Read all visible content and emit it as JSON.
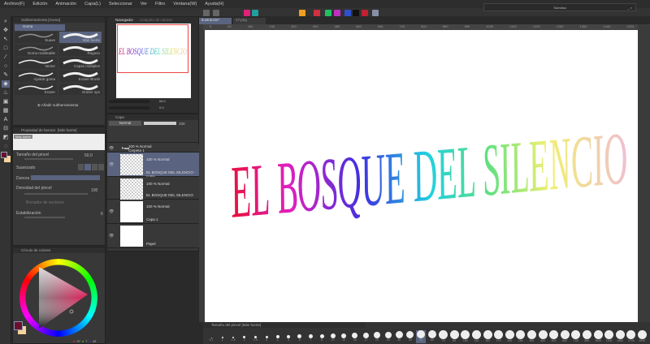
{
  "menu": [
    "Archivo(F)",
    "Edición",
    "Animación",
    "Capa(L)",
    "Seleccionar",
    "Ver",
    "Filtro",
    "Ventana(W)",
    "Ayuda(H)"
  ],
  "colors": {
    "accent": "#5a6480",
    "main_color": "#6b1030",
    "sub_color": "#f5d49a"
  },
  "subview": {
    "title": "Subvista"
  },
  "subtool": {
    "tab": "Subherramienta [Goma]",
    "group": "Goma",
    "brushes": [
      "Suave",
      "Más fuerte",
      "Goma moldeable",
      "Rugoso",
      "Vector",
      "Capas múltiples",
      "Ajustar goma",
      "Eraser Brush",
      "Eraser",
      "Eraser 1px"
    ],
    "add": "Añadir subherramienta"
  },
  "navigator": {
    "tabs": [
      "Navegador",
      "Conjunto de colores"
    ],
    "zoom": "66.0",
    "angle": "0.0"
  },
  "toolprop": {
    "tab": "Propiedad de herram. [Más fuerte]",
    "preset": "Más fuerte",
    "size_label": "Tamaño del pincel",
    "size_value": "50.0",
    "smooth_label": "Suavizado",
    "hardness_label": "Dureza",
    "density_label": "Densidad del pincel",
    "density_value": "100",
    "vector_label": "Borrador de vectores",
    "stab_label": "Estabilización",
    "stab_value": "6"
  },
  "colorwheel": {
    "tab": "Círculo de colores",
    "r": "97",
    "g": "7",
    "b": "43"
  },
  "layers": {
    "tab": "Capa",
    "blend": "Normal",
    "opacity": "100",
    "items": [
      {
        "mode": "100 % Normal",
        "name": "Carpeta 1"
      },
      {
        "mode": "100 % Normal",
        "name": "EL BOSQUE DEL SILENCIO - copia"
      },
      {
        "mode": "100 % Normal",
        "name": "EL BOSQUE DEL SILENCIO"
      },
      {
        "mode": "100 % Normal",
        "name": "Capa 1"
      },
      {
        "mode": "",
        "name": "Papel"
      }
    ]
  },
  "canvas": {
    "tabs": [
      "Ilustración*",
      "17.png"
    ],
    "title": "EL BOSQUE DEL SILENCIO",
    "ruler": [
      "0",
      "80",
      "160",
      "240",
      "320",
      "400",
      "480",
      "560",
      "640",
      "720",
      "800",
      "880",
      "960",
      "1040",
      "1120",
      "1200",
      "1280",
      "1360",
      "1440",
      "1520",
      "1600",
      "1680",
      "1760",
      "1840",
      "1920"
    ]
  },
  "brushsize": {
    "tab": "Tamaño del pincel [Más fuerte]",
    "selected": "50",
    "sizes": [
      "0.7",
      "1",
      "1.5",
      "2",
      "2.5",
      "3",
      "4",
      "5",
      "6",
      "7",
      "8",
      "10",
      "12",
      "15",
      "17",
      "20",
      "25",
      "30",
      "40",
      "50",
      "60",
      "70",
      "80",
      "100",
      "120",
      "150",
      "170",
      "200",
      "250",
      "300",
      "400",
      "500",
      "600",
      "700",
      "800",
      "1000",
      "1200",
      "1500",
      "1700",
      "2000"
    ]
  }
}
